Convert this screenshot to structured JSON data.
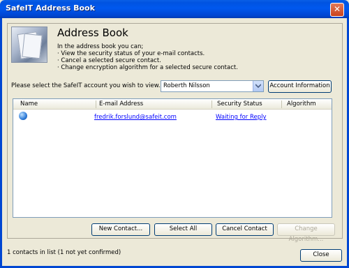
{
  "window": {
    "title": "SafeIT Address Book",
    "close_glyph": "✕"
  },
  "header": {
    "title": "Address Book",
    "intro_lines": [
      "In the address book you can;",
      "·  View the security status of your e-mail contacts.",
      "·  Cancel a selected secure contact.",
      "·  Change encryption algorithm for a selected secure contact."
    ],
    "image_icon": "address-book-image"
  },
  "account": {
    "label": "Please select the SafeIT account you wish to view.",
    "selected": "Roberth Nilsson",
    "info_button": "Account Information"
  },
  "table": {
    "columns": [
      "Name",
      "E-mail Address",
      "Security Status",
      "Algorithm"
    ],
    "rows": [
      {
        "icon": "globe-contact-icon",
        "name": "",
        "email": "fredrik.forslund@safeit.com",
        "status": "Waiting for Reply",
        "algorithm": ""
      }
    ]
  },
  "buttons": {
    "new_contact": "New Contact...",
    "select_all": "Select All",
    "cancel_contact": "Cancel Contact",
    "change_algorithm": "Change Algorithm...",
    "close": "Close"
  },
  "status_bar": {
    "text": "1 contacts in list (1 not yet confirmed)"
  },
  "colors": {
    "titlebar": "#0058ee",
    "dialog_bg": "#ece9d8",
    "link": "#0000ff"
  }
}
